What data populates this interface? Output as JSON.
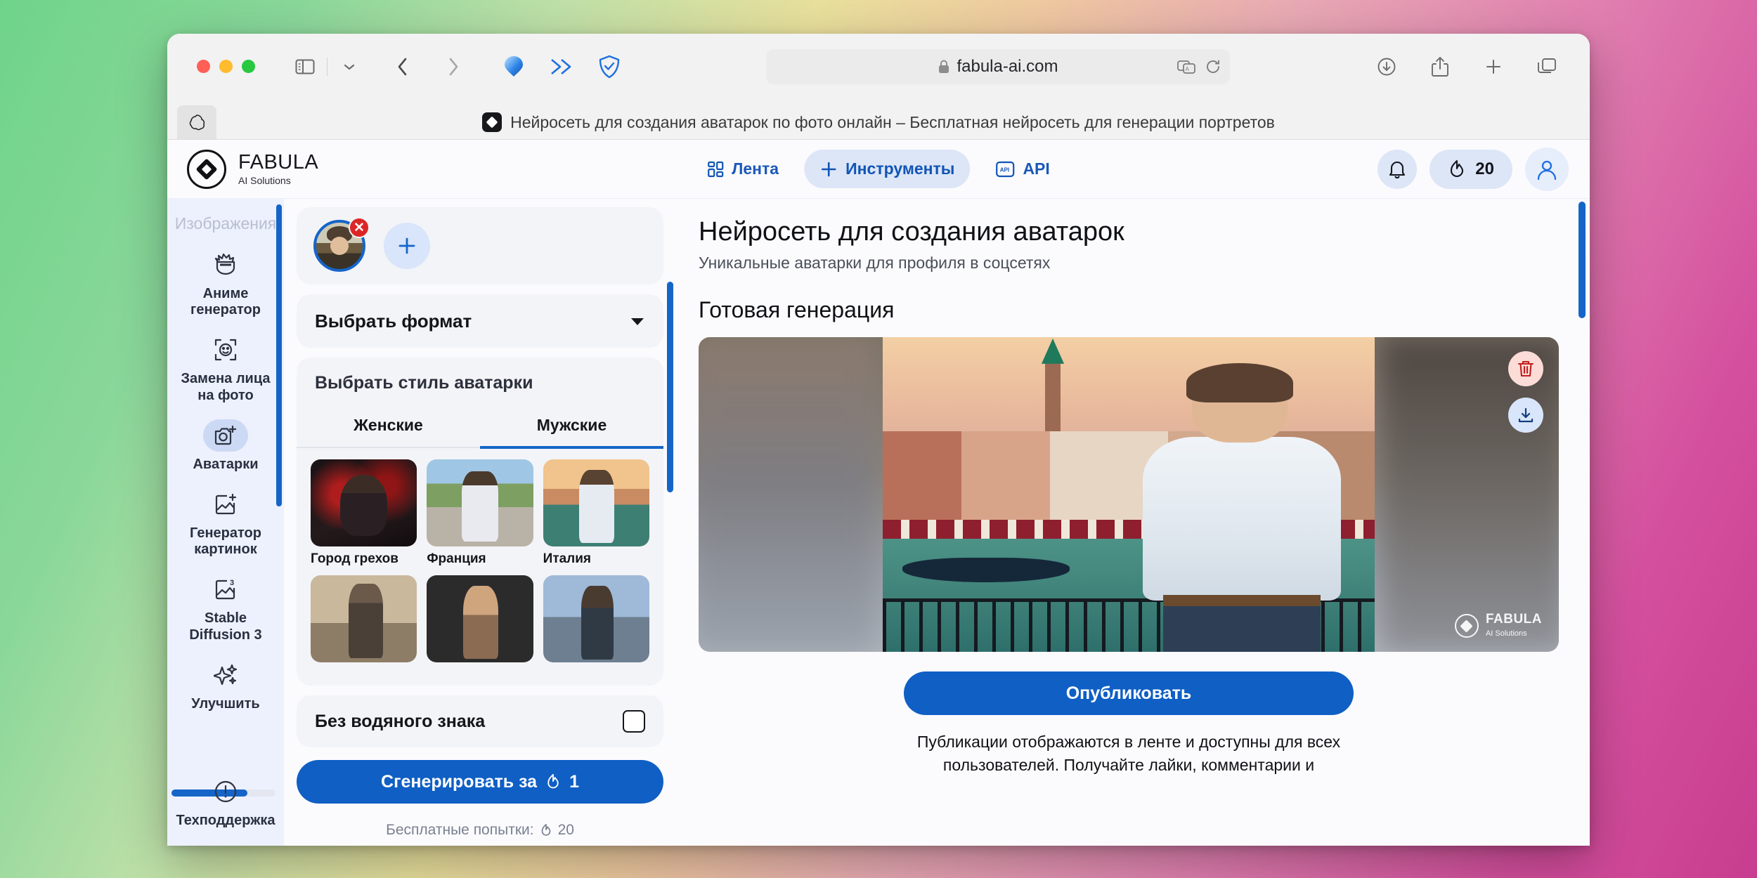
{
  "browser": {
    "url": "fabula-ai.com",
    "tab_title": "Нейросеть для создания аватарок по фото онлайн – Бесплатная нейросеть для генерации портретов"
  },
  "header": {
    "brand_name": "FABULA",
    "brand_sub": "AI Solutions",
    "nav": [
      {
        "label": "Лента",
        "icon": "grid-icon",
        "active": false
      },
      {
        "label": "Инструменты",
        "icon": "plus-icon",
        "active": true
      },
      {
        "label": "API",
        "icon": "api-icon",
        "active": false
      }
    ],
    "credits": "20"
  },
  "sidebar": {
    "title": "Изображения",
    "items": [
      {
        "label": "Аниме\nгенератор",
        "icon": "anime-face-icon",
        "active": false
      },
      {
        "label": "Замена лица\nна фото",
        "icon": "face-swap-icon",
        "active": false
      },
      {
        "label": "Аватарки",
        "icon": "camera-plus-icon",
        "active": true
      },
      {
        "label": "Генератор\nкартинок",
        "icon": "image-plus-icon",
        "active": false
      },
      {
        "label": "Stable\nDiffusion 3",
        "icon": "image-3-icon",
        "active": false
      },
      {
        "label": "Улучшить",
        "icon": "sparkles-icon",
        "active": false
      }
    ],
    "support": {
      "label": "Техподдержка",
      "icon": "info-circle-icon"
    }
  },
  "panel": {
    "format_select": "Выбрать формат",
    "style_title": "Выбрать стиль аватарки",
    "tabs": [
      {
        "label": "Женские",
        "active": false
      },
      {
        "label": "Мужские",
        "active": true
      }
    ],
    "styles_row1": [
      {
        "name": "Город грехов"
      },
      {
        "name": "Франция"
      },
      {
        "name": "Италия"
      }
    ],
    "styles_row2": [
      {
        "name": ""
      },
      {
        "name": ""
      },
      {
        "name": ""
      }
    ],
    "watermark_option": "Без водяного знака",
    "generate_button": "Сгенерировать за",
    "generate_cost": "1",
    "free_attempts_label": "Бесплатные попытки:",
    "free_attempts_value": "20"
  },
  "content": {
    "title": "Нейросеть для создания аватарок",
    "subtitle": "Уникальные аватарки для профиля в соцсетях",
    "section_title": "Готовая генерация",
    "image_watermark_name": "FABULA",
    "image_watermark_sub": "AI Solutions",
    "publish_button": "Опубликовать",
    "publish_note": "Публикации отображаются в ленте и доступны для всех пользователей. Получайте лайки, комментарии и"
  },
  "colors": {
    "accent": "#0f5fc4",
    "accent_soft": "#dde6f7",
    "danger": "#dc2626",
    "panel_bg": "#f3f4f8",
    "page_bg": "#fbfbfe"
  }
}
